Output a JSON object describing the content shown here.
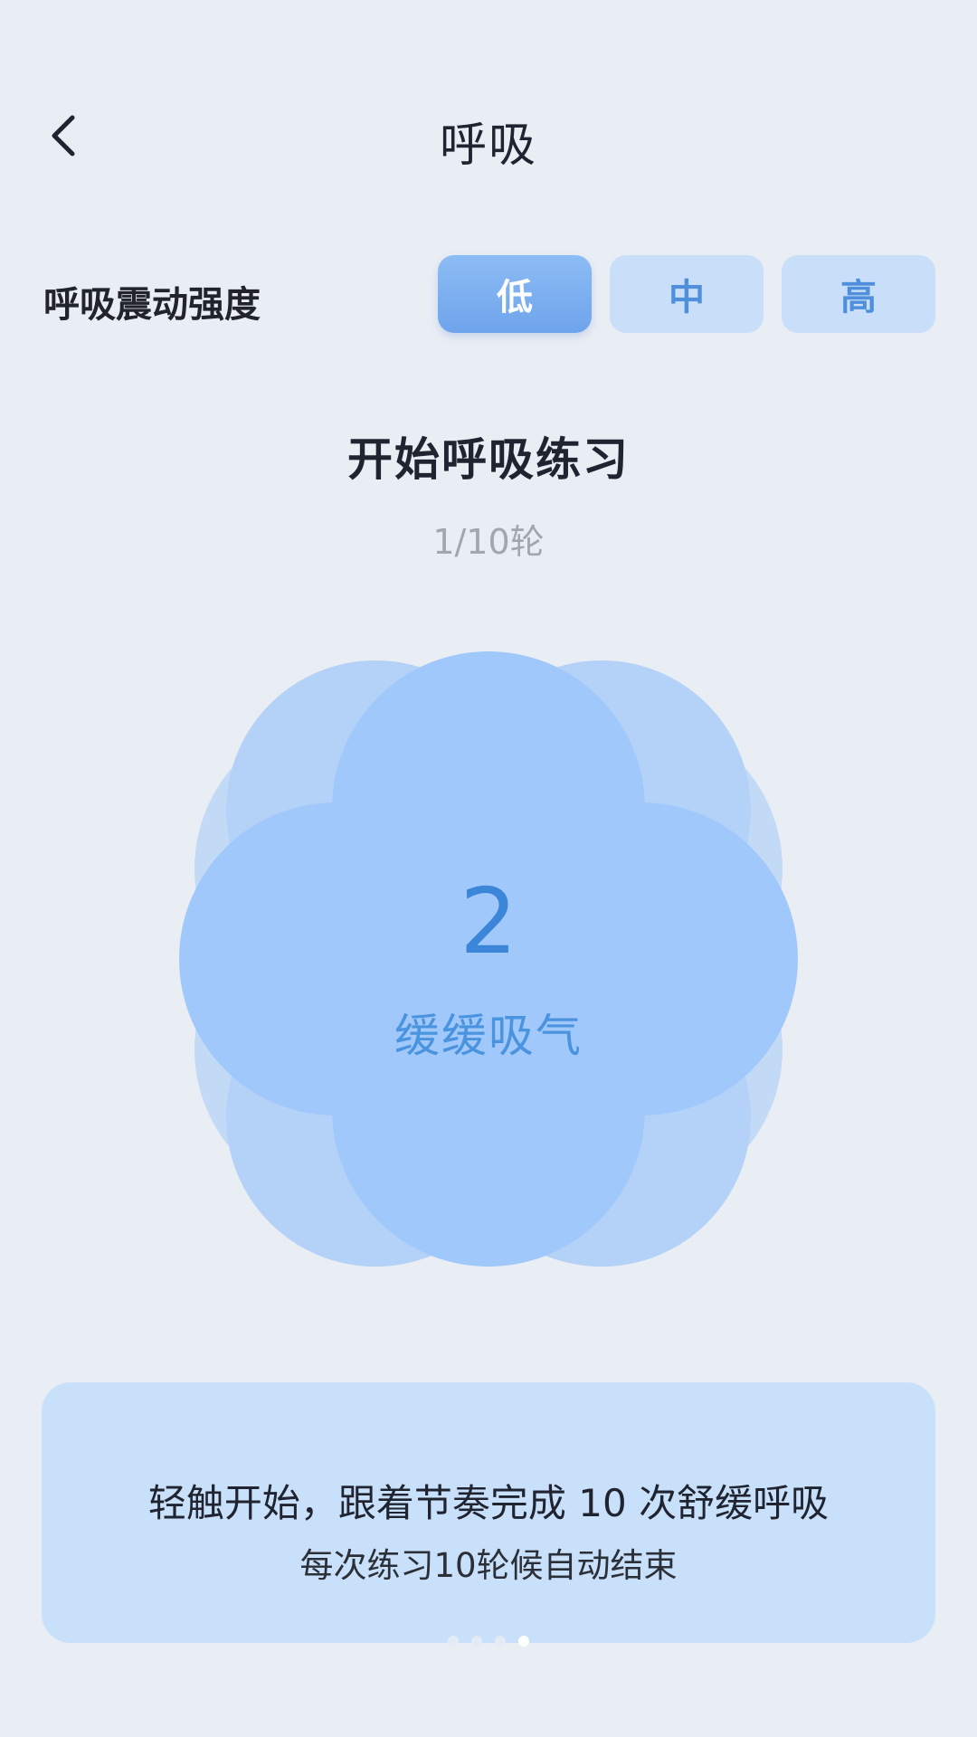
{
  "header": {
    "title": "呼吸",
    "back_icon": "chevron-left-icon"
  },
  "intensity": {
    "label": "呼吸震动强度",
    "options": [
      "低",
      "中",
      "高"
    ],
    "selected": "低"
  },
  "practice": {
    "title": "开始呼吸练习",
    "round": "1/10轮"
  },
  "breathing": {
    "count": "2",
    "instruction": "缓缓吸气"
  },
  "info": {
    "main": "轻触开始，跟着节奏完成 10 次舒缓呼吸",
    "sub": "每次练习10轮候自动结束"
  },
  "pager": {
    "total": 4,
    "active_index": 3
  },
  "colors": {
    "background": "#e9edf4",
    "accent": "#6ea4ec",
    "segment_inactive": "#c9def8",
    "flower_strong": "#a1c8fa",
    "flower_light": "#c3daf7",
    "number_text": "#3b86d8",
    "card_bg": "#c9e0fb"
  }
}
